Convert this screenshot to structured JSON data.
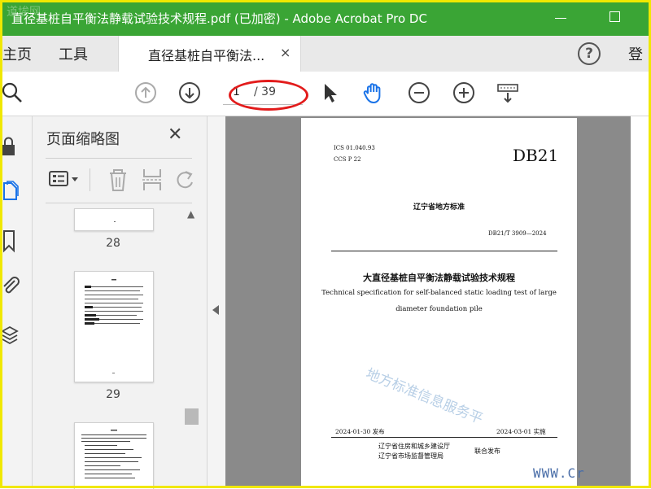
{
  "window": {
    "title": "直径基桩自平衡法静载试验技术规程.pdf  (已加密)  - Adobe Acrobat Pro DC",
    "watermark": "道埃网"
  },
  "tabs": {
    "home": "主页",
    "tools": "工具",
    "document": "直径基桩自平衡法...",
    "close": "×",
    "login": "登"
  },
  "toolbar": {
    "page_current": "1",
    "page_total": "/ 39"
  },
  "panel": {
    "title": "页面缩略图",
    "close": "✕",
    "thumbnails": [
      {
        "page": "28"
      },
      {
        "page": "29"
      }
    ]
  },
  "document": {
    "ics": "ICS 01.040.93",
    "ccs": "CCS P 22",
    "db": "DB21",
    "standard_type": "辽宁省地方标准",
    "code": "DB21/T 3909—2024",
    "title_cn": "大直径基桩自平衡法静载试验技术规程",
    "title_en_1": "Technical specification for self-balanced static loading test of large",
    "title_en_2": "diameter foundation pile",
    "watermark": "地方标准信息服务平",
    "publish_date": "2024-01-30 发布",
    "effective_date": "2024-03-01 实施",
    "issuer_1": "辽宁省住房和城乡建设厅",
    "issuer_2": "辽宁省市场监督管理局",
    "joint": "联合发布"
  },
  "site_watermark": "WWW.Cr",
  "colors": {
    "titlebar": "#3aa535",
    "frame": "#f0e800",
    "highlight": "#e21b1b",
    "accent": "#1a73e8"
  }
}
